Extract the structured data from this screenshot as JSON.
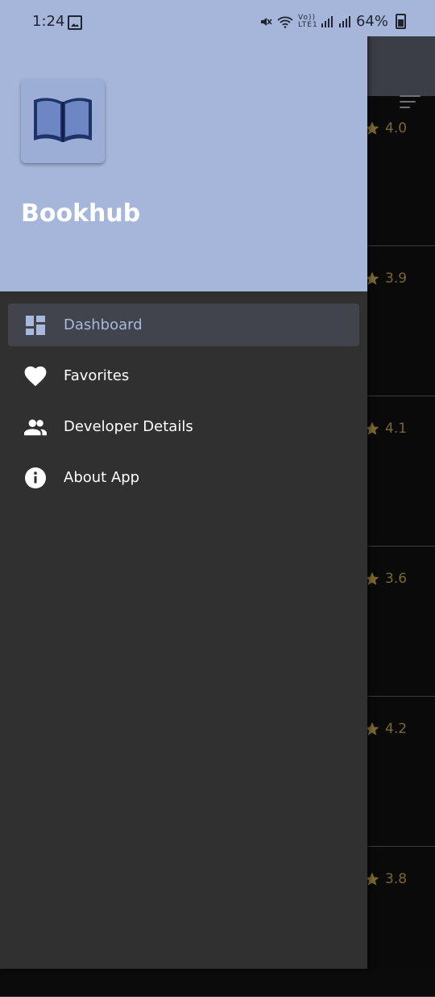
{
  "status_bar": {
    "time": "1:24",
    "network_label": "Vo)) LTE1",
    "battery": "64%"
  },
  "drawer": {
    "app_name": "Bookhub",
    "menu": [
      {
        "label": "Dashboard",
        "icon": "dashboard-icon",
        "active": true
      },
      {
        "label": "Favorites",
        "icon": "heart-icon",
        "active": false
      },
      {
        "label": "Developer Details",
        "icon": "people-icon",
        "active": false
      },
      {
        "label": "About App",
        "icon": "info-icon",
        "active": false
      }
    ]
  },
  "background_list": {
    "ratings": [
      "4.0",
      "3.9",
      "4.1",
      "3.6",
      "4.2",
      "3.8"
    ]
  },
  "colors": {
    "header_bg": "#a6b6db",
    "drawer_bg": "#303030",
    "active_item_bg": "#42444b",
    "active_text": "#a8b8df",
    "rating_gold": "#7a6630"
  }
}
